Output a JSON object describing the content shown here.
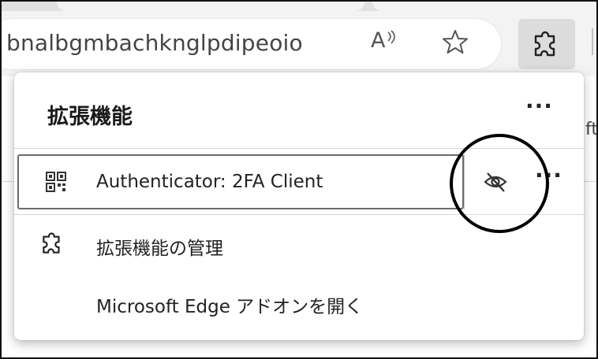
{
  "toolbar": {
    "url_text": "bnalbgmbachknglpdipeoio",
    "read_aloud_label": "A",
    "read_aloud_icon": "read-aloud-icon",
    "favorite_icon": "star-outline-icon",
    "extensions_icon": "puzzle-piece-icon"
  },
  "page": {
    "peek_text": "ft"
  },
  "popup": {
    "title": "拡張機能",
    "more_label": "···",
    "extension": {
      "name": "Authenticator: 2FA Client",
      "icon": "qr-code-icon",
      "visibility_icon": "eye-hidden-icon",
      "more_label": "···"
    },
    "manage_label": "拡張機能の管理",
    "manage_icon": "puzzle-piece-icon",
    "addons_label": "Microsoft Edge アドオンを開く"
  },
  "colors": {
    "toolbar_bg": "#f3f3f3",
    "selected_button_bg": "#dcdcdc",
    "annotation": "#000000"
  }
}
